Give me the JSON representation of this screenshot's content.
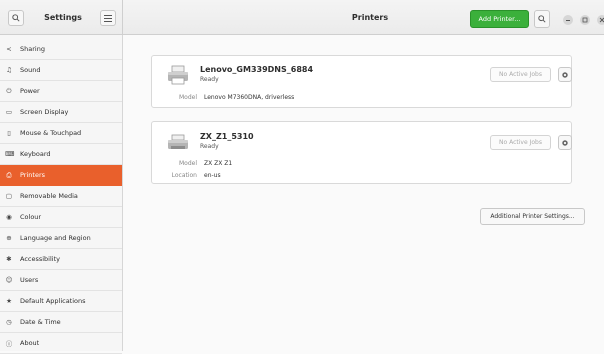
{
  "header": {
    "settings_title": "Settings",
    "page_title": "Printers",
    "add_printer_label": "Add Printer...",
    "accent_color": "#3bb03b"
  },
  "sidebar": {
    "active_color": "#e9602c",
    "items": [
      {
        "label": "Sharing",
        "icon": "share-icon",
        "glyph": "<"
      },
      {
        "label": "Sound",
        "icon": "music-note-icon",
        "glyph": "♫"
      },
      {
        "label": "Power",
        "icon": "power-icon",
        "glyph": "⏻"
      },
      {
        "label": "Screen Display",
        "icon": "monitor-icon",
        "glyph": "▭"
      },
      {
        "label": "Mouse & Touchpad",
        "icon": "mouse-icon",
        "glyph": "▯"
      },
      {
        "label": "Keyboard",
        "icon": "keyboard-icon",
        "glyph": "⌨"
      },
      {
        "label": "Printers",
        "icon": "printer-icon",
        "glyph": "⎙",
        "active": true
      },
      {
        "label": "Removable Media",
        "icon": "removable-media-icon",
        "glyph": "▢"
      },
      {
        "label": "Colour",
        "icon": "colour-icon",
        "glyph": "◉"
      },
      {
        "label": "Language and Region",
        "icon": "globe-icon",
        "glyph": "⊕"
      },
      {
        "label": "Accessibility",
        "icon": "accessibility-icon",
        "glyph": "✱"
      },
      {
        "label": "Users",
        "icon": "users-icon",
        "glyph": "☺"
      },
      {
        "label": "Default Applications",
        "icon": "star-icon",
        "glyph": "★"
      },
      {
        "label": "Date & Time",
        "icon": "clock-icon",
        "glyph": "◷"
      },
      {
        "label": "About",
        "icon": "info-icon",
        "glyph": "ⓘ"
      }
    ]
  },
  "printers": [
    {
      "name": "Lenovo_GM339DNS_6884",
      "status": "Ready",
      "model_label": "Model",
      "model": "Lenovo M7360DNA, driverless",
      "jobs_label": "No Active Jobs"
    },
    {
      "name": "ZX_Z1_5310",
      "status": "Ready",
      "model_label": "Model",
      "model": "ZX ZX Z1",
      "location_label": "Location",
      "location": "en-us",
      "jobs_label": "No Active Jobs"
    }
  ],
  "additional_settings_label": "Additional Printer Settings..."
}
